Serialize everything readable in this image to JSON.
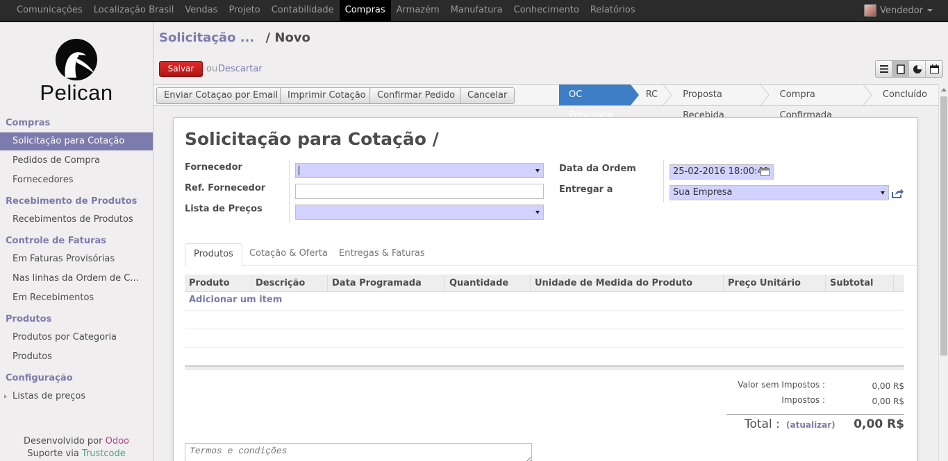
{
  "topbar": {
    "menu": [
      "Comunicações",
      "Localização Brasil",
      "Vendas",
      "Projeto",
      "Contabilidade",
      "Compras",
      "Armazém",
      "Manufatura",
      "Conhecimento",
      "Relatórios"
    ],
    "active": "Compras",
    "user": "Vendedor"
  },
  "sidebar": {
    "logo_text": "Pelican",
    "sections": [
      {
        "title": "Compras",
        "items": [
          "Solicitação para Cotação",
          "Pedidos de Compra",
          "Fornecedores"
        ]
      },
      {
        "title": "Recebimento de Produtos",
        "items": [
          "Recebimentos de Produtos"
        ]
      },
      {
        "title": "Controle de Faturas",
        "items": [
          "Em Faturas Provisórias",
          "Nas linhas da Ordem de C...",
          "Em Recebimentos"
        ]
      },
      {
        "title": "Produtos",
        "items": [
          "Produtos por Categoria",
          "Produtos"
        ]
      },
      {
        "title": "Configuração",
        "items": [
          "Listas de preços"
        ]
      }
    ],
    "active_item": "Solicitação para Cotação",
    "footer": {
      "developed_by": "Desenvolvido por",
      "odoo": "Odoo",
      "support": "Suporte via",
      "trustcode": "Trustcode"
    }
  },
  "breadcrumb": {
    "parent": "Solicitação ...",
    "separator": "/",
    "current": "Novo"
  },
  "actions": {
    "save": "Salvar",
    "or": "ou",
    "discard": "Descartar"
  },
  "header": {
    "buttons": [
      "Enviar Cotaçao por Email",
      "Imprimir Cotação",
      "Confirmar Pedido",
      "Cancelar"
    ],
    "states": [
      "OC Provisória",
      "RC",
      "Proposta Recebida",
      "Compra Confirmada",
      "Concluído"
    ],
    "current_state": "OC Provisória"
  },
  "form": {
    "title": "Solicitação para Cotação /",
    "fields_left": {
      "supplier_label": "Fornecedor",
      "supplier_value": "",
      "supplier_ref_label": "Ref. Fornecedor",
      "supplier_ref_value": "",
      "pricelist_label": "Lista de Preços",
      "pricelist_value": ""
    },
    "fields_right": {
      "order_date_label": "Data da Ordem",
      "order_date_value": "25-02-2016 18:00:40",
      "deliver_to_label": "Entregar a",
      "deliver_to_value": "Sua Empresa"
    },
    "tabs": [
      "Produtos",
      "Cotação & Oferta",
      "Entregas & Faturas"
    ],
    "active_tab": "Produtos",
    "table": {
      "columns": [
        "Produto",
        "Descrição",
        "Data Programada",
        "Quantidade",
        "Unidade de Medida do Produto",
        "Preço Unitário",
        "Subtotal"
      ],
      "add_item": "Adicionar um item"
    },
    "totals": {
      "untaxed_label": "Valor sem Impostos :",
      "untaxed_value": "0,00 R$",
      "taxes_label": "Impostos :",
      "taxes_value": "0,00 R$",
      "total_label": "Total :",
      "update": "(atualizar)",
      "total_value": "0,00 R$"
    },
    "terms_placeholder": "Termos e condições"
  }
}
